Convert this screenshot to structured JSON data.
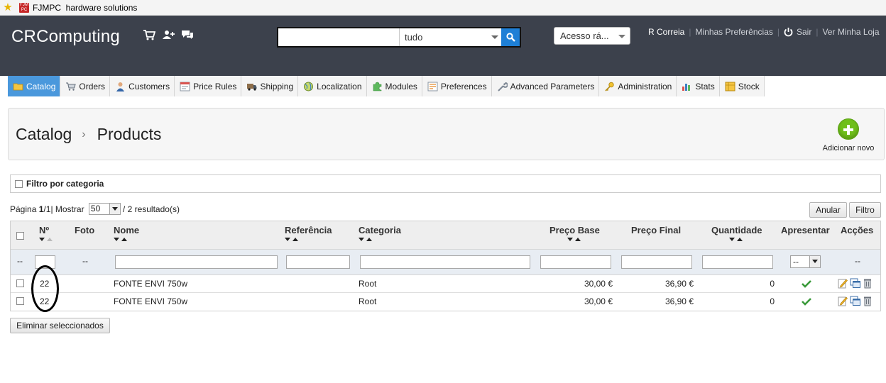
{
  "browser": {
    "favorite_label": "FJMPC  hardware solutions",
    "favicon_text": "FJM PC"
  },
  "header": {
    "brand": "CRComputing",
    "search": {
      "value": "",
      "scope": "tudo"
    },
    "quick_access": "Acesso rá...",
    "user_name": "R Correia",
    "preferences_link": "Minhas Preferências",
    "logout_label": "Sair",
    "view_shop_link": "Ver Minha Loja"
  },
  "tabs": [
    {
      "label": "Catalog",
      "icon": "folder-icon",
      "active": true
    },
    {
      "label": "Orders",
      "icon": "cart-icon"
    },
    {
      "label": "Customers",
      "icon": "user-icon"
    },
    {
      "label": "Price Rules",
      "icon": "price-tag-icon"
    },
    {
      "label": "Shipping",
      "icon": "truck-icon"
    },
    {
      "label": "Localization",
      "icon": "globe-icon"
    },
    {
      "label": "Modules",
      "icon": "puzzle-icon"
    },
    {
      "label": "Preferences",
      "icon": "preferences-icon"
    },
    {
      "label": "Advanced Parameters",
      "icon": "wrench-icon"
    },
    {
      "label": "Administration",
      "icon": "key-icon"
    },
    {
      "label": "Stats",
      "icon": "bar-chart-icon"
    },
    {
      "label": "Stock",
      "icon": "stock-icon"
    }
  ],
  "breadcrumb": {
    "section": "Catalog",
    "page": "Products",
    "separator": "›"
  },
  "add_new_label": "Adicionar novo",
  "category_filter_label": "Filtro por categoria",
  "pagination": {
    "page_label": "Página",
    "current": "1",
    "sep": " / ",
    "total_pages": "1",
    "show_label": " | Mostrar",
    "per_page": "50",
    "results": " / 2 resultado(s)"
  },
  "buttons": {
    "reset": "Anular",
    "filter": "Filtro",
    "delete_selected": "Eliminar seleccionados"
  },
  "table": {
    "columns": {
      "id": "Nº",
      "photo": "Foto",
      "name": "Nome",
      "reference": "Referência",
      "category": "Categoria",
      "base_price": "Preço Base",
      "final_price": "Preço Final",
      "quantity": "Quantidade",
      "show": "Apresentar",
      "actions": "Acções"
    },
    "filter_placeholder_dash": "--",
    "filter_active_value": "--",
    "rows": [
      {
        "id": "22",
        "name": "FONTE ENVI 750w",
        "category": "Root",
        "base_price": "30,00 €",
        "final_price": "36,90 €",
        "quantity": "0",
        "active": true
      },
      {
        "id": "22",
        "name": "FONTE ENVI 750w",
        "category": "Root",
        "base_price": "30,00 €",
        "final_price": "36,90 €",
        "quantity": "0",
        "active": true
      }
    ]
  },
  "colors": {
    "header_bg": "#3c414c",
    "active_tab": "#4a98dc",
    "search_button": "#1e7fd6",
    "add_button": "#6fbf1a",
    "check": "#3a9a3a"
  }
}
